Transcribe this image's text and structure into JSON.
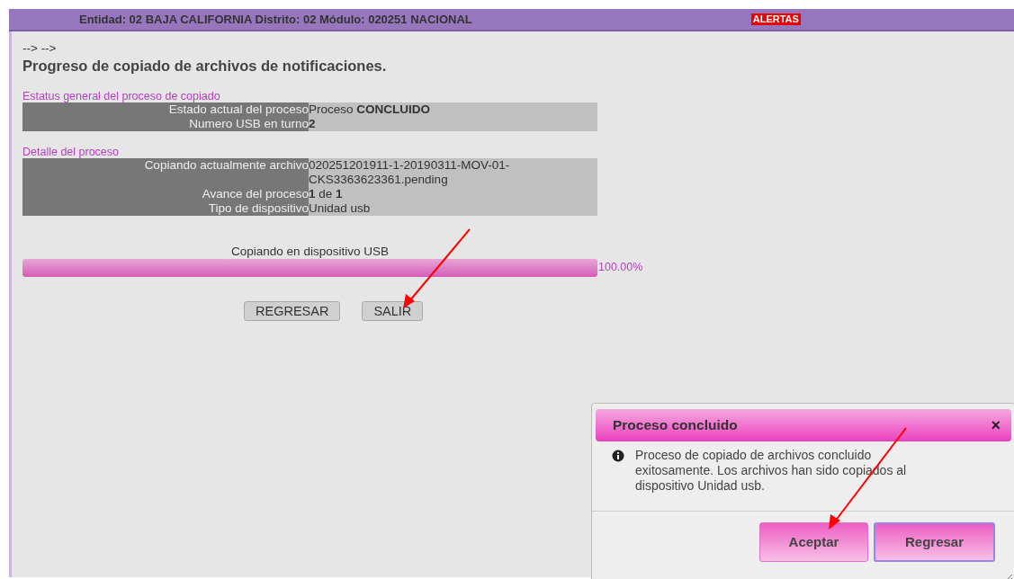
{
  "header": {
    "location": "Entidad: 02 BAJA CALIFORNIA Distrito: 02 Módulo: 020251 NACIONAL",
    "alert": "ALERTAS"
  },
  "breadcrumb": "--> -->",
  "title": "Progreso de copiado de archivos de notificaciones.",
  "sections": [
    {
      "heading": "Estatus general del proceso de copiado",
      "rows": [
        {
          "label": "Estado actual del proceso",
          "value": "Proceso **CONCLUIDO**",
          "bold": false
        },
        {
          "label": "Numero USB en turno",
          "value": "2",
          "bold": true
        }
      ]
    },
    {
      "heading": "Detalle del proceso",
      "rows": [
        {
          "label": "Copiando actualmente archivo",
          "value": "020251201911-1-20190311-MOV-01-CKS3363623361.pending",
          "bold": false
        },
        {
          "label": "Avance del proceso",
          "value": "**1** de **1**",
          "bold": false
        },
        {
          "label": "Tipo de dispositivo",
          "value": "Unidad usb",
          "bold": false
        }
      ]
    }
  ],
  "progress": {
    "label": "Copiando en dispositivo USB",
    "level": 1.0,
    "reading": "100.00%"
  },
  "buttons": [
    "REGRESAR",
    "SALIR"
  ],
  "dialog": {
    "title": "Proceso concluido",
    "close": "×",
    "message": "Proceso de copiado de archivos concluido exitosamente. Los archivos han sido copiados al dispositivo Unidad usb.",
    "buttons": [
      {
        "label": "Aceptar",
        "focused": false
      },
      {
        "label": "Regresar",
        "focused": true
      }
    ]
  }
}
